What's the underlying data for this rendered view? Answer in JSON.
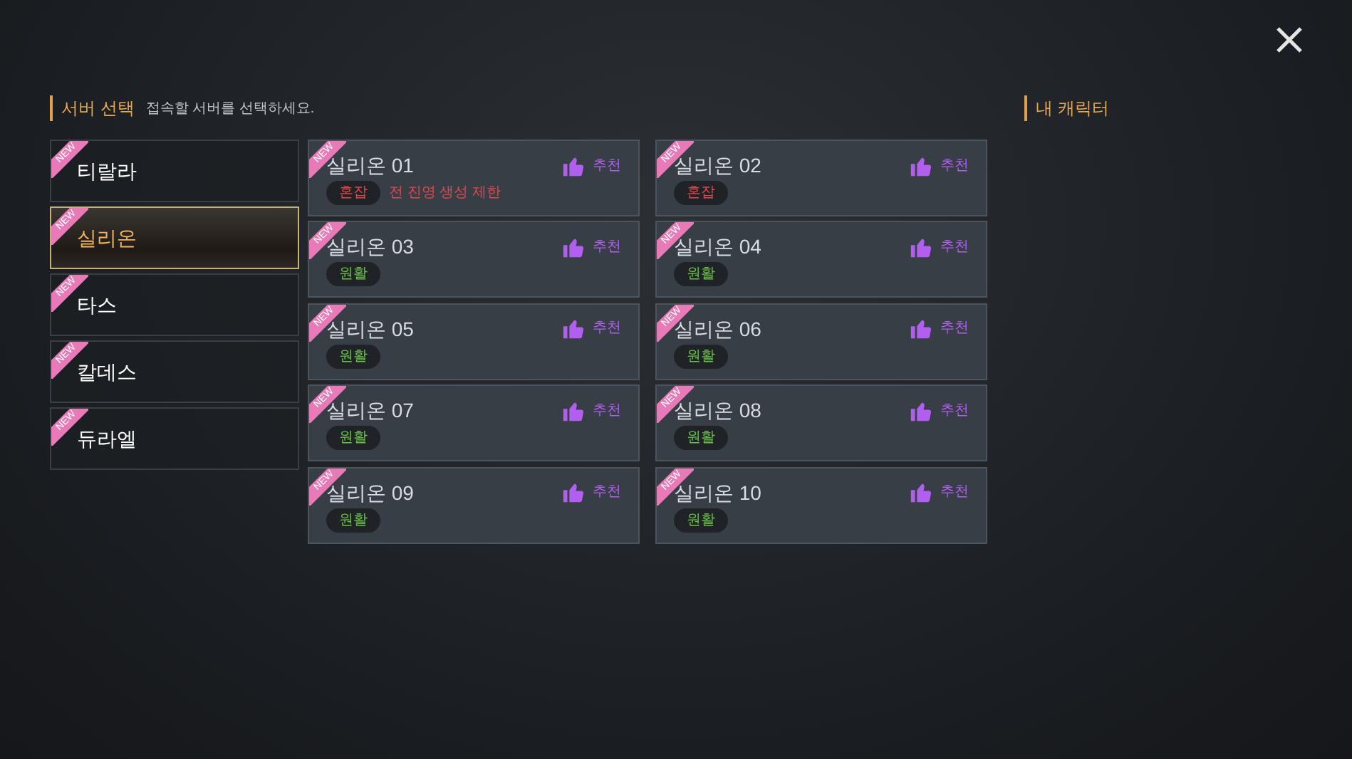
{
  "header": {
    "title": "서버 선택",
    "hint": "접속할 서버를 선택하세요."
  },
  "my_characters": {
    "title": "내 캐릭터"
  },
  "worlds": [
    {
      "name": "티랄라",
      "badge": "NEW",
      "selected": false
    },
    {
      "name": "실리온",
      "badge": "NEW",
      "selected": true
    },
    {
      "name": "타스",
      "badge": "NEW",
      "selected": false
    },
    {
      "name": "칼데스",
      "badge": "NEW",
      "selected": false
    },
    {
      "name": "듀라엘",
      "badge": "NEW",
      "selected": false
    }
  ],
  "servers": [
    {
      "name": "실리온 01",
      "badge": "NEW",
      "recommend": "추천",
      "status": "혼잡",
      "kind": "busy",
      "note": "전 진영 생성 제한"
    },
    {
      "name": "실리온 02",
      "badge": "NEW",
      "recommend": "추천",
      "status": "혼잡",
      "kind": "busy"
    },
    {
      "name": "실리온 03",
      "badge": "NEW",
      "recommend": "추천",
      "status": "원활",
      "kind": "smooth"
    },
    {
      "name": "실리온 04",
      "badge": "NEW",
      "recommend": "추천",
      "status": "원활",
      "kind": "smooth"
    },
    {
      "name": "실리온 05",
      "badge": "NEW",
      "recommend": "추천",
      "status": "원활",
      "kind": "smooth"
    },
    {
      "name": "실리온 06",
      "badge": "NEW",
      "recommend": "추천",
      "status": "원활",
      "kind": "smooth"
    },
    {
      "name": "실리온 07",
      "badge": "NEW",
      "recommend": "추천",
      "status": "원활",
      "kind": "smooth"
    },
    {
      "name": "실리온 08",
      "badge": "NEW",
      "recommend": "추천",
      "status": "원활",
      "kind": "smooth"
    },
    {
      "name": "실리온 09",
      "badge": "NEW",
      "recommend": "추천",
      "status": "원활",
      "kind": "smooth"
    },
    {
      "name": "실리온 10",
      "badge": "NEW",
      "recommend": "추천",
      "status": "원활",
      "kind": "smooth"
    }
  ]
}
